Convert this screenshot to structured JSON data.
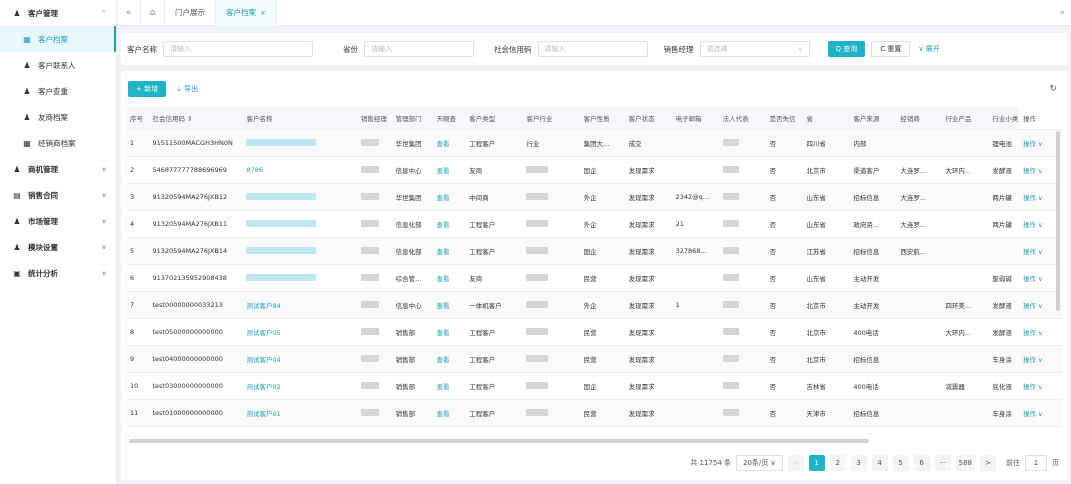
{
  "sidebar": {
    "items": [
      {
        "label": "客户管理",
        "icon": "user-icon",
        "level": "group",
        "chevron": "^"
      },
      {
        "label": "客户档案",
        "icon": "grid-icon",
        "level": "sub",
        "active": true
      },
      {
        "label": "客户联系人",
        "icon": "user-icon",
        "level": "sub"
      },
      {
        "label": "客户查重",
        "icon": "user-icon",
        "level": "sub"
      },
      {
        "label": "友商档案",
        "icon": "user-icon",
        "level": "sub"
      },
      {
        "label": "经销商档案",
        "icon": "grid-icon",
        "level": "sub"
      },
      {
        "label": "商机管理",
        "icon": "user-icon",
        "level": "group",
        "chevron": "v"
      },
      {
        "label": "销售合同",
        "icon": "doc-icon",
        "level": "group",
        "chevron": "v"
      },
      {
        "label": "市场管理",
        "icon": "user-icon",
        "level": "group",
        "chevron": "v"
      },
      {
        "label": "模块设置",
        "icon": "user-icon",
        "level": "group",
        "chevron": "v"
      },
      {
        "label": "统计分析",
        "icon": "chart-icon",
        "level": "group",
        "chevron": "v"
      }
    ]
  },
  "tabbar": {
    "back_icon": "«",
    "home_icon": "⌂",
    "tabs": [
      {
        "label": "门户展示"
      },
      {
        "label": "客户档案",
        "active": true,
        "close": "×"
      }
    ],
    "more_icon": "»"
  },
  "search": {
    "fields": [
      {
        "label": "客户名称",
        "placeholder": "请输入",
        "width": 150
      },
      {
        "label": "省份",
        "placeholder": "请输入",
        "width": 110
      },
      {
        "label": "社会信用码",
        "placeholder": "请输入",
        "width": 110
      },
      {
        "label": "销售经理",
        "placeholder": "请选择",
        "width": 110,
        "dropdown": true
      }
    ],
    "query_label": "Q 查询",
    "reset_label": "C 重置",
    "expand_label": "∨ 展开"
  },
  "toolbar": {
    "new_label": "+ 新增",
    "export_label": "⇣ 导出",
    "refresh_icon": "↻"
  },
  "table": {
    "columns": [
      "序号",
      "社会信用码 ⇕",
      "客户名称",
      "销售经理",
      "管理部门",
      "天眼查",
      "客户类型",
      "客户行业",
      "客户性质",
      "客户状态",
      "电子邮箱",
      "法人代表",
      "是否失信",
      "省",
      "客户来源",
      "经销商",
      "行业产品",
      "行业小类",
      "操作"
    ],
    "rows": [
      {
        "no": "1",
        "code": "91511500MACGH3HN0N",
        "name": "",
        "mgr": "",
        "dept": "华世集团",
        "tyc": "查看",
        "type": "工程客户",
        "ind": "行业",
        "nature": "集团大...",
        "status": "成交",
        "email": "",
        "legal": "",
        "credit": "否",
        "prov": "四川省",
        "src": "内部",
        "dealer": "",
        "prod": "",
        "sub": "锂电池",
        "op": "操作 ∨"
      },
      {
        "no": "2",
        "code": "546877777788696969",
        "name": "8786",
        "mgr": "",
        "dept": "信息中心",
        "tyc": "查看",
        "type": "友商",
        "ind": "",
        "nature": "国企",
        "status": "发现需求",
        "email": "",
        "legal": "",
        "credit": "否",
        "prov": "北京市",
        "src": "渠道客户",
        "dealer": "大连罗...",
        "prod": "大环内...",
        "sub": "发酵液",
        "op": "操作 ∨"
      },
      {
        "no": "3",
        "code": "91320594MA276JXB12",
        "name": "",
        "mgr": "",
        "dept": "华世集团",
        "tyc": "查看",
        "type": "中间商",
        "ind": "",
        "nature": "外企",
        "status": "发现需求",
        "email": "2342@q...",
        "legal": "",
        "credit": "否",
        "prov": "山东省",
        "src": "招标信息",
        "dealer": "大连罗...",
        "prod": "",
        "sub": "两片罐",
        "op": "操作 ∨"
      },
      {
        "no": "4",
        "code": "91320594MA276JXB11",
        "name": "",
        "mgr": "",
        "dept": "信息化部",
        "tyc": "查看",
        "type": "工程客户",
        "ind": "",
        "nature": "外企",
        "status": "发现需求",
        "email": "21",
        "legal": "",
        "credit": "否",
        "prov": "山东省",
        "src": "政府资...",
        "dealer": "大连罗...",
        "prod": "",
        "sub": "两片罐",
        "op": "操作 ∨"
      },
      {
        "no": "5",
        "code": "91320594MA276JXB14",
        "name": "",
        "mgr": "",
        "dept": "信息化部",
        "tyc": "查看",
        "type": "工程客户",
        "ind": "",
        "nature": "国企",
        "status": "发现需求",
        "email": "327868...",
        "legal": "",
        "credit": "否",
        "prov": "江苏省",
        "src": "招标信息",
        "dealer": "西安航...",
        "prod": "",
        "sub": "",
        "op": "操作 ∨"
      },
      {
        "no": "6",
        "code": "913702135952908438",
        "name": "",
        "mgr": "",
        "dept": "综合管...",
        "tyc": "查看",
        "type": "友商",
        "ind": "",
        "nature": "民营",
        "status": "发现需求",
        "email": "",
        "legal": "",
        "credit": "否",
        "prov": "山东省",
        "src": "主动开发",
        "dealer": "",
        "prod": "",
        "sub": "废弱碱",
        "op": "操作 ∨"
      },
      {
        "no": "7",
        "code": "test00000000033213",
        "name": "测试客户84",
        "mgr": "",
        "dept": "信息中心",
        "tyc": "查看",
        "type": "一体机客户",
        "ind": "",
        "nature": "外企",
        "status": "发现需求",
        "email": "1",
        "legal": "",
        "credit": "否",
        "prov": "北京市",
        "src": "主动开发",
        "dealer": "",
        "prod": "四环美...",
        "sub": "发酵液",
        "op": "操作 ∨"
      },
      {
        "no": "8",
        "code": "test05000000000000",
        "name": "测试客户05",
        "mgr": "",
        "dept": "销售部",
        "tyc": "查看",
        "type": "工程客户",
        "ind": "",
        "nature": "民营",
        "status": "发现需求",
        "email": "",
        "legal": "",
        "credit": "否",
        "prov": "北京市",
        "src": "400电话",
        "dealer": "",
        "prod": "大环内...",
        "sub": "发酵液",
        "op": "操作 ∨"
      },
      {
        "no": "9",
        "code": "test04000000000000",
        "name": "测试客户04",
        "mgr": "",
        "dept": "销售部",
        "tyc": "查看",
        "type": "工程客户",
        "ind": "",
        "nature": "民营",
        "status": "发现需求",
        "email": "",
        "legal": "",
        "credit": "否",
        "prov": "北京市",
        "src": "招标信息",
        "dealer": "",
        "prod": "",
        "sub": "车身涂",
        "op": "操作 ∨"
      },
      {
        "no": "10",
        "code": "test03000000000000",
        "name": "测试客户02",
        "mgr": "",
        "dept": "销售部",
        "tyc": "查看",
        "type": "工程客户",
        "ind": "",
        "nature": "国企",
        "status": "发现需求",
        "email": "",
        "legal": "",
        "credit": "否",
        "prov": "吉林省",
        "src": "400电话",
        "dealer": "",
        "prod": "减震器",
        "sub": "底化液",
        "op": "操作 ∨"
      },
      {
        "no": "11",
        "code": "test01000000000000",
        "name": "测试客户01",
        "mgr": "",
        "dept": "销售部",
        "tyc": "查看",
        "type": "工程客户",
        "ind": "",
        "nature": "民营",
        "status": "发现需求",
        "email": "",
        "legal": "",
        "credit": "否",
        "prov": "天津市",
        "src": "招标信息",
        "dealer": "",
        "prod": "",
        "sub": "车身涂",
        "op": "操作 ∨"
      }
    ]
  },
  "pager": {
    "total": "共 11754 条",
    "page_size": "20条/页 ∨",
    "prev": "<",
    "pages": [
      "1",
      "2",
      "3",
      "4",
      "5",
      "6",
      "···",
      "588"
    ],
    "next": ">",
    "goto_label": "前往",
    "goto_value": "1",
    "page_unit": "页"
  }
}
